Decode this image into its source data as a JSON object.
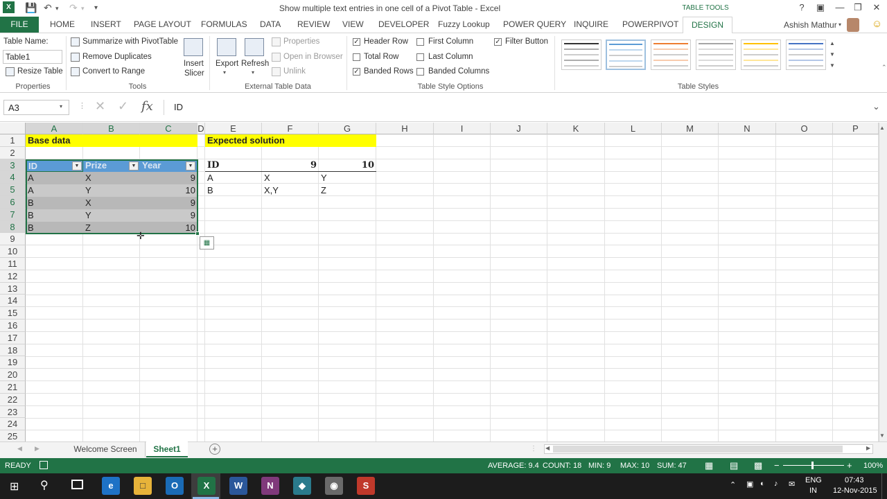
{
  "window": {
    "title": "Show multiple text entries in one cell of a Pivot Table - Excel",
    "contextual_tab_group": "TABLE TOOLS",
    "user": "Ashish Mathur"
  },
  "ribbon": {
    "tabs": [
      "FILE",
      "HOME",
      "INSERT",
      "PAGE LAYOUT",
      "FORMULAS",
      "DATA",
      "REVIEW",
      "VIEW",
      "DEVELOPER",
      "Fuzzy Lookup",
      "POWER QUERY",
      "INQUIRE",
      "POWERPIVOT",
      "DESIGN"
    ],
    "properties": {
      "table_name_label": "Table Name:",
      "table_name_value": "Table1",
      "resize_table": "Resize Table",
      "group": "Properties"
    },
    "tools": {
      "summarize": "Summarize with PivotTable",
      "remove_duplicates": "Remove Duplicates",
      "convert_to_range": "Convert to Range",
      "insert_slicer_1": "Insert",
      "insert_slicer_2": "Slicer",
      "group": "Tools"
    },
    "external": {
      "export": "Export",
      "refresh": "Refresh",
      "properties": "Properties",
      "open_in_browser": "Open in Browser",
      "unlink": "Unlink",
      "group": "External Table Data"
    },
    "style_options": {
      "header_row": "Header Row",
      "total_row": "Total Row",
      "banded_rows": "Banded Rows",
      "first_column": "First Column",
      "last_column": "Last Column",
      "banded_columns": "Banded Columns",
      "filter_button": "Filter Button",
      "group": "Table Style Options"
    },
    "styles": {
      "group": "Table Styles",
      "swatch_colors": [
        "#333333",
        "#5b9bd5",
        "#ed7d31",
        "#a5a5a5",
        "#ffc000",
        "#4472c4"
      ]
    }
  },
  "formula_bar": {
    "name_box": "A3",
    "fx": "fx",
    "formula": "ID"
  },
  "columns": [
    "A",
    "B",
    "C",
    "D",
    "E",
    "F",
    "G",
    "H",
    "I",
    "J",
    "K",
    "L",
    "M",
    "N",
    "O",
    "P"
  ],
  "rows": [
    "1",
    "2",
    "3",
    "4",
    "5",
    "6",
    "7",
    "8",
    "9",
    "10",
    "11",
    "12",
    "13",
    "14",
    "15",
    "16",
    "17",
    "18",
    "19",
    "20",
    "21",
    "22",
    "23",
    "24",
    "25"
  ],
  "cells": {
    "A1": "Base data",
    "E1": "Expected solution",
    "A3": "ID",
    "B3": "Prize",
    "C3": "Year",
    "A4": "A",
    "B4": "X",
    "C4": "9",
    "A5": "A",
    "B5": "Y",
    "C5": "10",
    "A6": "B",
    "B6": "X",
    "C6": "9",
    "A7": "B",
    "B7": "Y",
    "C7": "9",
    "A8": "B",
    "B8": "Z",
    "C8": "10",
    "E3": "ID",
    "F3": "9",
    "G3": "10",
    "E4": "A",
    "F4": "X",
    "G4": "Y",
    "E5": "B",
    "F5": "X,Y",
    "G5": "Z"
  },
  "sheets": {
    "tab1": "Welcome Screen",
    "tab2": "Sheet1",
    "active": "Sheet1"
  },
  "status": {
    "ready": "READY",
    "average": "AVERAGE: 9.4",
    "count": "COUNT: 18",
    "min": "MIN: 9",
    "max": "MAX: 10",
    "sum": "SUM: 47",
    "zoom": "100%"
  },
  "taskbar": {
    "lang1": "ENG",
    "lang2": "IN",
    "time": "07:43",
    "date": "12-Nov-2015"
  },
  "colors": {
    "excel_green": "#217346",
    "table_header": "#5b9bd5",
    "highlight": "#ffff00"
  }
}
